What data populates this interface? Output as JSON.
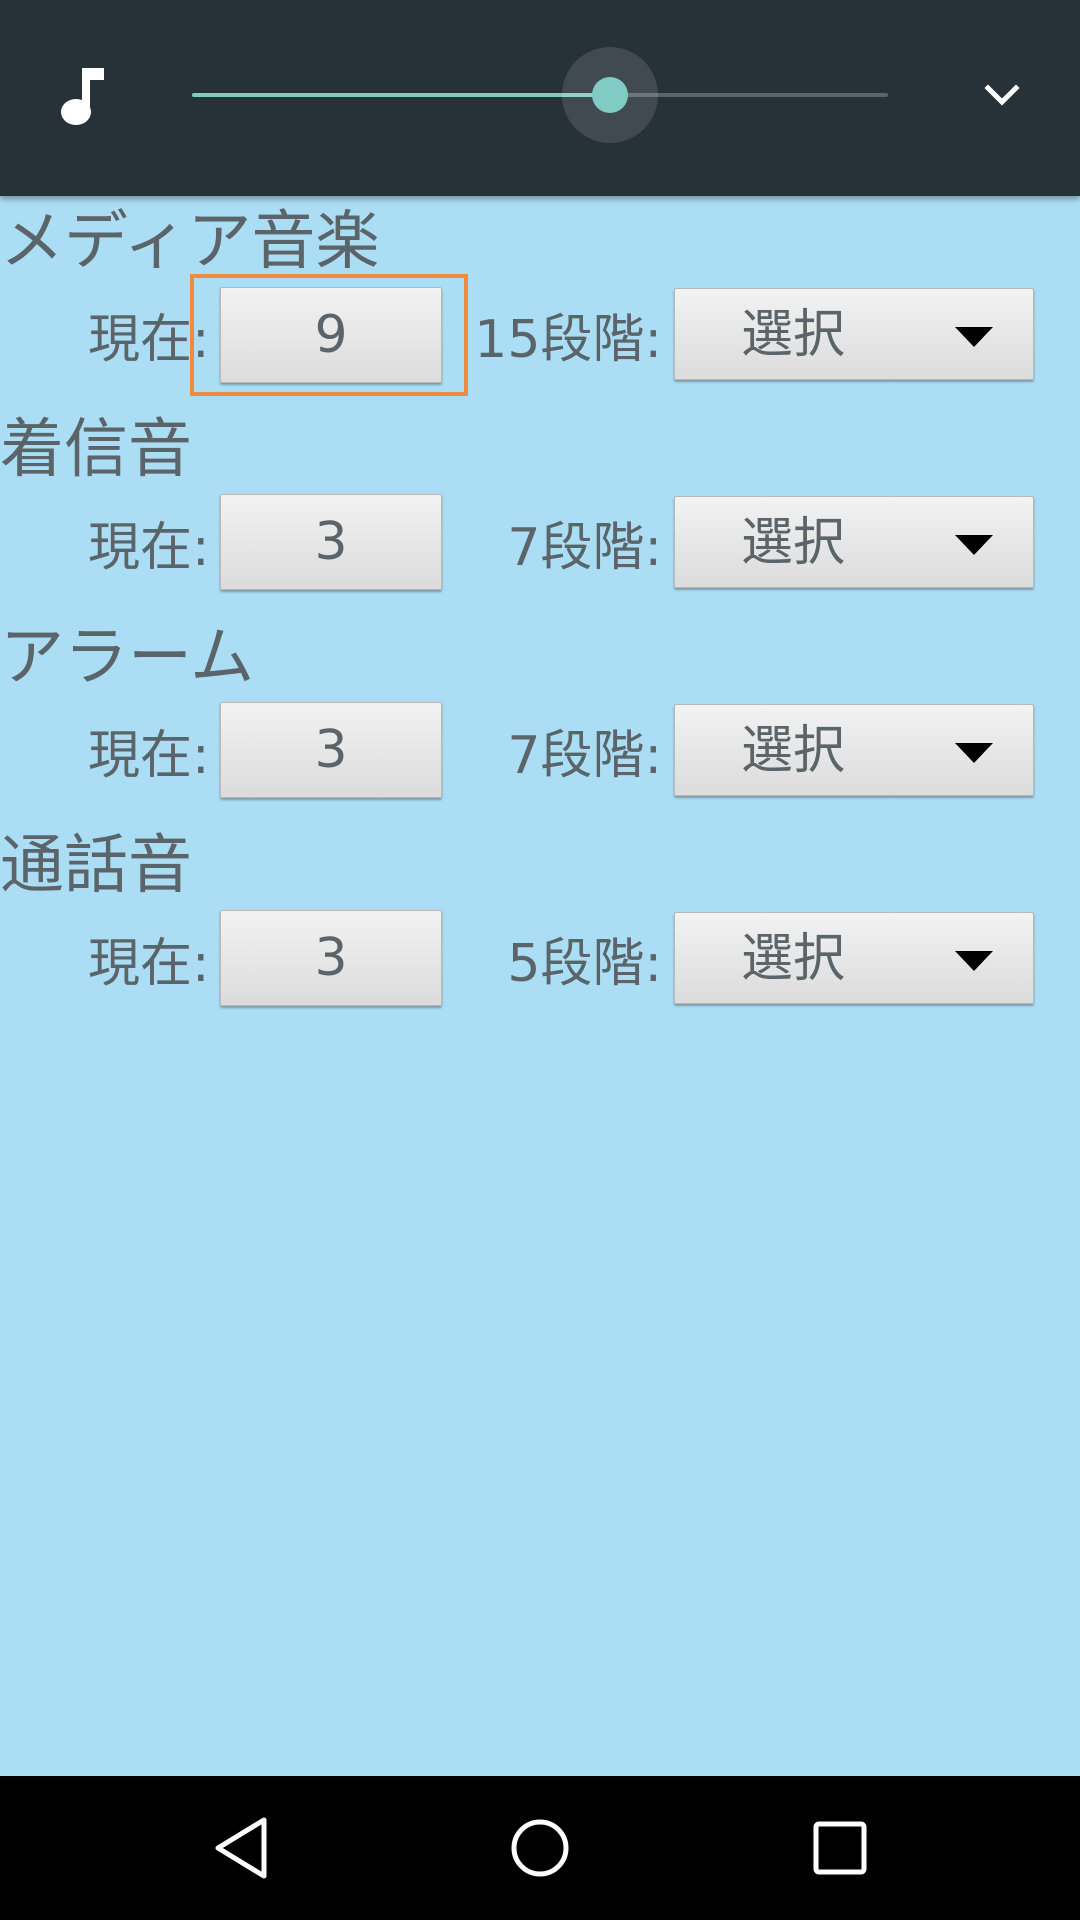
{
  "volume_panel": {
    "slider_level": 0.6,
    "icon": "music-note-icon",
    "expand_icon": "chevron-down-icon",
    "accent_color": "#80CBC4"
  },
  "sections": [
    {
      "title": "メディア音楽",
      "current_label": "現在:",
      "current_value": "9",
      "steps_label": "15段階:",
      "select_label": "選択"
    },
    {
      "title": "着信音",
      "current_label": "現在:",
      "current_value": "3",
      "steps_label": "7段階:",
      "select_label": "選択"
    },
    {
      "title": "アラーム",
      "current_label": "現在:",
      "current_value": "3",
      "steps_label": "7段階:",
      "select_label": "選択"
    },
    {
      "title": "通話音",
      "current_label": "現在:",
      "current_value": "3",
      "steps_label": "5段階:",
      "select_label": "選択"
    }
  ],
  "nav": {
    "back": "back-icon",
    "home": "home-icon",
    "recents": "recents-icon"
  },
  "colors": {
    "background": "#ABDEF4",
    "highlight": "#F08A3C"
  }
}
